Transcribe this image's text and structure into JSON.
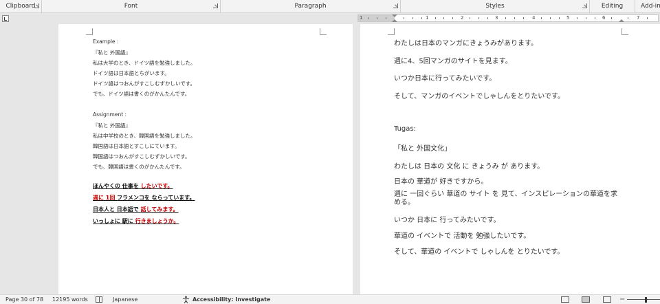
{
  "ribbon": {
    "groups": [
      {
        "label": "Clipboard"
      },
      {
        "label": "Font"
      },
      {
        "label": "Paragraph"
      },
      {
        "label": "Styles"
      },
      {
        "label": "Editing"
      },
      {
        "label": "Add-ins"
      }
    ]
  },
  "ruler": {
    "numbers": [
      "1",
      "1",
      "2",
      "3",
      "4",
      "5",
      "6",
      "7"
    ]
  },
  "left_page": {
    "example": {
      "heading": "Example :",
      "lines": [
        "『私と 外国語』",
        "私は大学のとき、ドイツ語を勉強しました。",
        "ドイツ語は日本語とちがいます。",
        "ドイツ語はつおんがすこしむずかしいです。",
        "でも、ドイツ語は書くのがかんたんです。"
      ]
    },
    "assignment": {
      "heading": "Assignment :",
      "lines": [
        "『私と 外国語』",
        "私は中学校のとき、韓国語を勉強しました。",
        "韓国語は日本語とすこしにています。",
        "韓国語はつおんがすこしむずかしいです。",
        "でも、韓国語は書くのがかんたんです。"
      ]
    },
    "bold_lines": [
      {
        "black1": "ほんやくの 仕事を ",
        "red1": "したいです。",
        "black2": "",
        "red2": ""
      },
      {
        "black1": "",
        "red1": "週に 1回 ",
        "black2": "フラメンコを ならっています。",
        "red2": ""
      },
      {
        "black1": "日本人と 日本語で ",
        "red1": "話してみます。",
        "black2": "",
        "red2": ""
      },
      {
        "black1": "いっしょに 駅に ",
        "red1": "行きましょうか。",
        "black2": "",
        "red2": ""
      }
    ]
  },
  "right_page": {
    "top_lines": [
      "わたしは日本のマンガにきょうみがあります。",
      "週に4、5回マンガのサイトを見ます。",
      "いつか日本に行ってみたいです。",
      "そして、マンガのイベントでしゃしんをとりたいです。"
    ],
    "tugas_label": "Tugas:",
    "tugas_title": "「私と 外国文化」",
    "tugas_lines": [
      "わたしは 日本の 文化 に きょうみ が あります。",
      "日本の 華道が 好きですから。",
      "週に 一回ぐらい 華道の サイト を 見て、インスピレーションの華道を求める。",
      "いつか 日本に 行ってみたいです。",
      "華道の イベントで 活動を 勉強したいです。",
      "そして、華道の イベントで しゃしんを とりたいです。"
    ]
  },
  "statusbar": {
    "page": "Page 30 of 78",
    "words": "12195 words",
    "language": "Japanese",
    "accessibility": "Accessibility: Investigate",
    "zoom_minus": "−"
  }
}
